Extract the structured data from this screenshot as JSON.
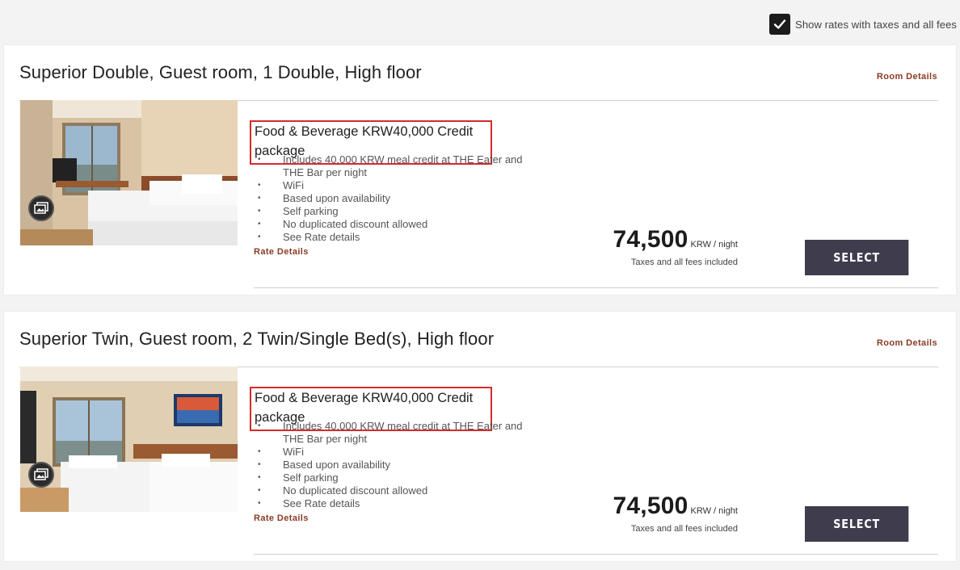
{
  "tax_toggle": {
    "checked": true,
    "label": "Show rates with taxes and all fees"
  },
  "rooms": [
    {
      "title": "Superior Double, Guest room, 1 Double, High floor",
      "room_details_label": "Room Details",
      "photo_icon": "gallery-icon",
      "rate": {
        "name": "Food & Beverage KRW40,000 Credit package",
        "features": [
          "Includes 40,000 KRW meal credit at THE Eater and THE Bar per night",
          "WiFi",
          "Based upon availability",
          "Self parking",
          "No duplicated discount allowed",
          "See Rate details"
        ],
        "rate_details_label": "Rate Details",
        "price": "74,500",
        "price_unit": "KRW / night",
        "price_note": "Taxes and all fees included",
        "select_label": "SELECT"
      }
    },
    {
      "title": "Superior Twin, Guest room, 2 Twin/Single Bed(s), High floor",
      "room_details_label": "Room Details",
      "photo_icon": "gallery-icon",
      "rate": {
        "name": "Food & Beverage KRW40,000 Credit package",
        "features": [
          "Includes 40,000 KRW meal credit at THE Eater and THE Bar per night",
          "WiFi",
          "Based upon availability",
          "Self parking",
          "No duplicated discount allowed",
          "See Rate details"
        ],
        "rate_details_label": "Rate Details",
        "price": "74,500",
        "price_unit": "KRW / night",
        "price_note": "Taxes and all fees included",
        "select_label": "SELECT"
      }
    }
  ],
  "colors": {
    "accent_link": "#8a3b24",
    "select_button": "#3f3c4e",
    "highlight_box": "#d52b2b"
  }
}
